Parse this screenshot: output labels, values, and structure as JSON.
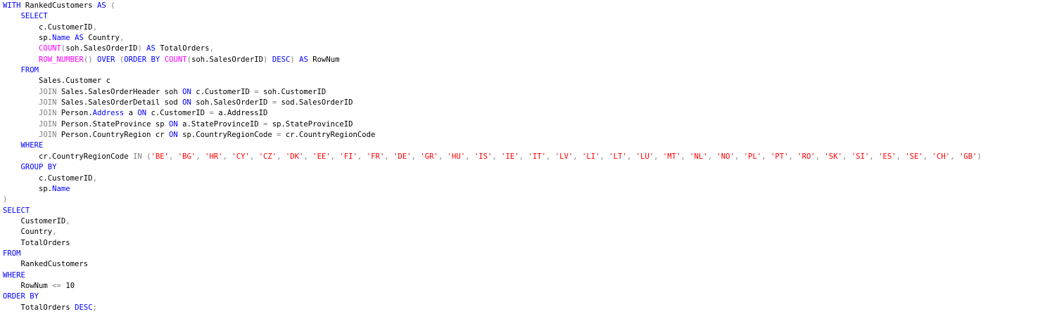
{
  "colors": {
    "keyword": "#0000ff",
    "function": "#ff00ff",
    "string": "#ff0000",
    "operator": "#808080",
    "identifier": "#000000",
    "builtin": "#0000ff",
    "background": "#ffffff"
  },
  "editor": {
    "lines": [
      [
        [
          "keyword",
          "WITH"
        ],
        [
          "plain",
          " RankedCustomers "
        ],
        [
          "keyword",
          "AS"
        ],
        [
          "plain",
          " "
        ],
        [
          "operator",
          "("
        ]
      ],
      [
        [
          "plain",
          "    "
        ],
        [
          "keyword",
          "SELECT"
        ]
      ],
      [
        [
          "plain",
          "        c.CustomerID"
        ],
        [
          "operator",
          ","
        ]
      ],
      [
        [
          "plain",
          "        sp."
        ],
        [
          "builtin",
          "Name"
        ],
        [
          "plain",
          " "
        ],
        [
          "keyword",
          "AS"
        ],
        [
          "plain",
          " Country"
        ],
        [
          "operator",
          ","
        ]
      ],
      [
        [
          "plain",
          "        "
        ],
        [
          "function",
          "COUNT"
        ],
        [
          "operator",
          "("
        ],
        [
          "plain",
          "soh.SalesOrderID"
        ],
        [
          "operator",
          ")"
        ],
        [
          "plain",
          " "
        ],
        [
          "keyword",
          "AS"
        ],
        [
          "plain",
          " TotalOrders"
        ],
        [
          "operator",
          ","
        ]
      ],
      [
        [
          "plain",
          "        "
        ],
        [
          "function",
          "ROW_NUMBER"
        ],
        [
          "operator",
          "()"
        ],
        [
          "plain",
          " "
        ],
        [
          "keyword",
          "OVER"
        ],
        [
          "plain",
          " "
        ],
        [
          "operator",
          "("
        ],
        [
          "keyword",
          "ORDER BY"
        ],
        [
          "plain",
          " "
        ],
        [
          "function",
          "COUNT"
        ],
        [
          "operator",
          "("
        ],
        [
          "plain",
          "soh.SalesOrderID"
        ],
        [
          "operator",
          ")"
        ],
        [
          "plain",
          " "
        ],
        [
          "keyword",
          "DESC"
        ],
        [
          "operator",
          ")"
        ],
        [
          "plain",
          " "
        ],
        [
          "keyword",
          "AS"
        ],
        [
          "plain",
          " RowNum"
        ]
      ],
      [
        [
          "plain",
          "    "
        ],
        [
          "keyword",
          "FROM"
        ]
      ],
      [
        [
          "plain",
          "        Sales.Customer c"
        ]
      ],
      [
        [
          "plain",
          "        "
        ],
        [
          "operator",
          "JOIN"
        ],
        [
          "plain",
          " Sales.SalesOrderHeader soh "
        ],
        [
          "keyword",
          "ON"
        ],
        [
          "plain",
          " c.CustomerID "
        ],
        [
          "operator",
          "="
        ],
        [
          "plain",
          " soh.CustomerID"
        ]
      ],
      [
        [
          "plain",
          "        "
        ],
        [
          "operator",
          "JOIN"
        ],
        [
          "plain",
          " Sales.SalesOrderDetail sod "
        ],
        [
          "keyword",
          "ON"
        ],
        [
          "plain",
          " soh.SalesOrderID "
        ],
        [
          "operator",
          "="
        ],
        [
          "plain",
          " sod.SalesOrderID"
        ]
      ],
      [
        [
          "plain",
          "        "
        ],
        [
          "operator",
          "JOIN"
        ],
        [
          "plain",
          " Person."
        ],
        [
          "builtin",
          "Address"
        ],
        [
          "plain",
          " a "
        ],
        [
          "keyword",
          "ON"
        ],
        [
          "plain",
          " c.CustomerID "
        ],
        [
          "operator",
          "="
        ],
        [
          "plain",
          " a.AddressID"
        ]
      ],
      [
        [
          "plain",
          "        "
        ],
        [
          "operator",
          "JOIN"
        ],
        [
          "plain",
          " Person.StateProvince sp "
        ],
        [
          "keyword",
          "ON"
        ],
        [
          "plain",
          " a.StateProvinceID "
        ],
        [
          "operator",
          "="
        ],
        [
          "plain",
          " sp.StateProvinceID"
        ]
      ],
      [
        [
          "plain",
          "        "
        ],
        [
          "operator",
          "JOIN"
        ],
        [
          "plain",
          " Person.CountryRegion cr "
        ],
        [
          "keyword",
          "ON"
        ],
        [
          "plain",
          " sp.CountryRegionCode "
        ],
        [
          "operator",
          "="
        ],
        [
          "plain",
          " cr.CountryRegionCode"
        ]
      ],
      [
        [
          "plain",
          "    "
        ],
        [
          "keyword",
          "WHERE"
        ]
      ],
      [
        [
          "plain",
          "        cr.CountryRegionCode "
        ],
        [
          "operator",
          "IN"
        ],
        [
          "plain",
          " "
        ],
        [
          "operator",
          "("
        ],
        [
          "string",
          "'BE'"
        ],
        [
          "operator",
          ", "
        ],
        [
          "string",
          "'BG'"
        ],
        [
          "operator",
          ", "
        ],
        [
          "string",
          "'HR'"
        ],
        [
          "operator",
          ", "
        ],
        [
          "string",
          "'CY'"
        ],
        [
          "operator",
          ", "
        ],
        [
          "string",
          "'CZ'"
        ],
        [
          "operator",
          ", "
        ],
        [
          "string",
          "'DK'"
        ],
        [
          "operator",
          ", "
        ],
        [
          "string",
          "'EE'"
        ],
        [
          "operator",
          ", "
        ],
        [
          "string",
          "'FI'"
        ],
        [
          "operator",
          ", "
        ],
        [
          "string",
          "'FR'"
        ],
        [
          "operator",
          ", "
        ],
        [
          "string",
          "'DE'"
        ],
        [
          "operator",
          ", "
        ],
        [
          "string",
          "'GR'"
        ],
        [
          "operator",
          ", "
        ],
        [
          "string",
          "'HU'"
        ],
        [
          "operator",
          ", "
        ],
        [
          "string",
          "'IS'"
        ],
        [
          "operator",
          ", "
        ],
        [
          "string",
          "'IE'"
        ],
        [
          "operator",
          ", "
        ],
        [
          "string",
          "'IT'"
        ],
        [
          "operator",
          ", "
        ],
        [
          "string",
          "'LV'"
        ],
        [
          "operator",
          ", "
        ],
        [
          "string",
          "'LI'"
        ],
        [
          "operator",
          ", "
        ],
        [
          "string",
          "'LT'"
        ],
        [
          "operator",
          ", "
        ],
        [
          "string",
          "'LU'"
        ],
        [
          "operator",
          ", "
        ],
        [
          "string",
          "'MT'"
        ],
        [
          "operator",
          ", "
        ],
        [
          "string",
          "'NL'"
        ],
        [
          "operator",
          ", "
        ],
        [
          "string",
          "'NO'"
        ],
        [
          "operator",
          ", "
        ],
        [
          "string",
          "'PL'"
        ],
        [
          "operator",
          ", "
        ],
        [
          "string",
          "'PT'"
        ],
        [
          "operator",
          ", "
        ],
        [
          "string",
          "'RO'"
        ],
        [
          "operator",
          ", "
        ],
        [
          "string",
          "'SK'"
        ],
        [
          "operator",
          ", "
        ],
        [
          "string",
          "'SI'"
        ],
        [
          "operator",
          ", "
        ],
        [
          "string",
          "'ES'"
        ],
        [
          "operator",
          ", "
        ],
        [
          "string",
          "'SE'"
        ],
        [
          "operator",
          ", "
        ],
        [
          "string",
          "'CH'"
        ],
        [
          "operator",
          ", "
        ],
        [
          "string",
          "'GB'"
        ],
        [
          "operator",
          ")"
        ]
      ],
      [
        [
          "plain",
          "    "
        ],
        [
          "keyword",
          "GROUP BY"
        ]
      ],
      [
        [
          "plain",
          "        c.CustomerID"
        ],
        [
          "operator",
          ","
        ]
      ],
      [
        [
          "plain",
          "        sp."
        ],
        [
          "builtin",
          "Name"
        ]
      ],
      [
        [
          "operator",
          ")"
        ]
      ],
      [
        [
          "keyword",
          "SELECT"
        ]
      ],
      [
        [
          "plain",
          "    CustomerID"
        ],
        [
          "operator",
          ","
        ]
      ],
      [
        [
          "plain",
          "    Country"
        ],
        [
          "operator",
          ","
        ]
      ],
      [
        [
          "plain",
          "    TotalOrders"
        ]
      ],
      [
        [
          "keyword",
          "FROM"
        ]
      ],
      [
        [
          "plain",
          "    RankedCustomers"
        ]
      ],
      [
        [
          "keyword",
          "WHERE"
        ]
      ],
      [
        [
          "plain",
          "    RowNum "
        ],
        [
          "operator",
          "<="
        ],
        [
          "plain",
          " 10"
        ]
      ],
      [
        [
          "keyword",
          "ORDER BY"
        ]
      ],
      [
        [
          "plain",
          "    TotalOrders "
        ],
        [
          "keyword",
          "DESC"
        ],
        [
          "operator",
          ";"
        ]
      ]
    ]
  }
}
